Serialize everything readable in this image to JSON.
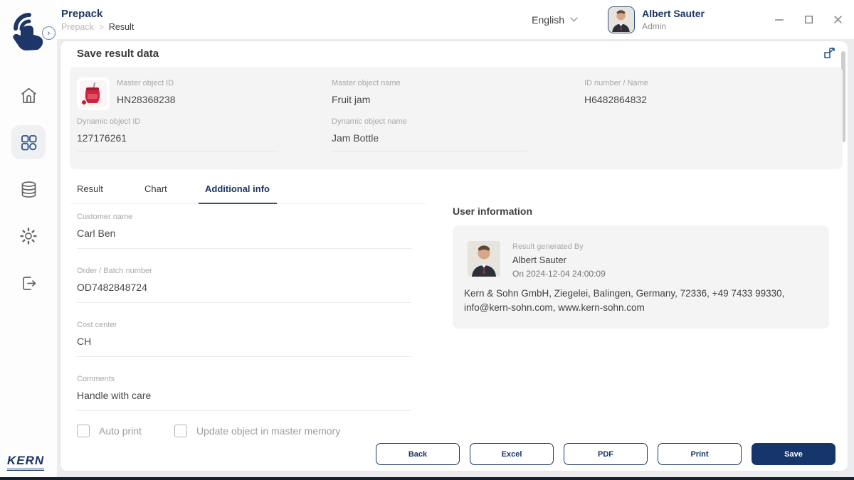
{
  "header": {
    "app_title": "Prepack",
    "breadcrumb": {
      "parent": "Prepack",
      "separator": ">",
      "current": "Result"
    },
    "language": {
      "selected": "English"
    },
    "user": {
      "name": "Albert Sauter",
      "role": "Admin"
    }
  },
  "sidebar": {
    "brand": "KERN",
    "items": [
      {
        "icon": "home-icon",
        "active": false
      },
      {
        "icon": "apps-grid-icon",
        "active": true
      },
      {
        "icon": "database-icon",
        "active": false
      },
      {
        "icon": "settings-gear-icon",
        "active": false
      },
      {
        "icon": "logout-icon",
        "active": false
      }
    ]
  },
  "page": {
    "title": "Save result data",
    "object_card": {
      "master_object_id": {
        "label": "Master object ID",
        "value": "HN28368238"
      },
      "master_object_name": {
        "label": "Master object name",
        "value": "Fruit jam"
      },
      "id_number_name": {
        "label": "ID number / Name",
        "value": "H6482864832"
      },
      "dynamic_object_id": {
        "label": "Dynamic object ID",
        "value": "127176261"
      },
      "dynamic_object_name": {
        "label": "Dynamic object name",
        "value": "Jam Bottle"
      }
    },
    "tabs": [
      {
        "label": "Result",
        "active": false
      },
      {
        "label": "Chart",
        "active": false
      },
      {
        "label": "Additional info",
        "active": true
      }
    ],
    "form": {
      "fields": [
        {
          "label": "Customer name",
          "value": "Carl Ben"
        },
        {
          "label": "Order / Batch number",
          "value": "OD7482848724"
        },
        {
          "label": "Cost center",
          "value": "CH"
        },
        {
          "label": "Comments",
          "value": "Handle with care"
        }
      ]
    },
    "user_information": {
      "title": "User information",
      "generated_by_label": "Result generated By",
      "generated_by_name": "Albert Sauter",
      "generated_on": "On 2024-12-04 24:00:09",
      "company_line": "Kern & Sohn GmbH, Ziegelei, Balingen, Germany, 72336, +49 7433 99330, info@kern-sohn.com, www.kern-sohn.com"
    },
    "options": [
      {
        "label": "Auto print",
        "checked": false
      },
      {
        "label": "Update object in master memory",
        "checked": false
      }
    ],
    "actions": [
      {
        "label": "Back",
        "style": "outline"
      },
      {
        "label": "Excel",
        "style": "outline"
      },
      {
        "label": "PDF",
        "style": "outline"
      },
      {
        "label": "Print",
        "style": "outline"
      },
      {
        "label": "Save",
        "style": "primary"
      }
    ]
  },
  "colors": {
    "primary_navy": "#16356b",
    "accent_blue": "#2d4f85",
    "panel_grey": "#f4f4f5",
    "label_grey": "#a8a8ac"
  }
}
